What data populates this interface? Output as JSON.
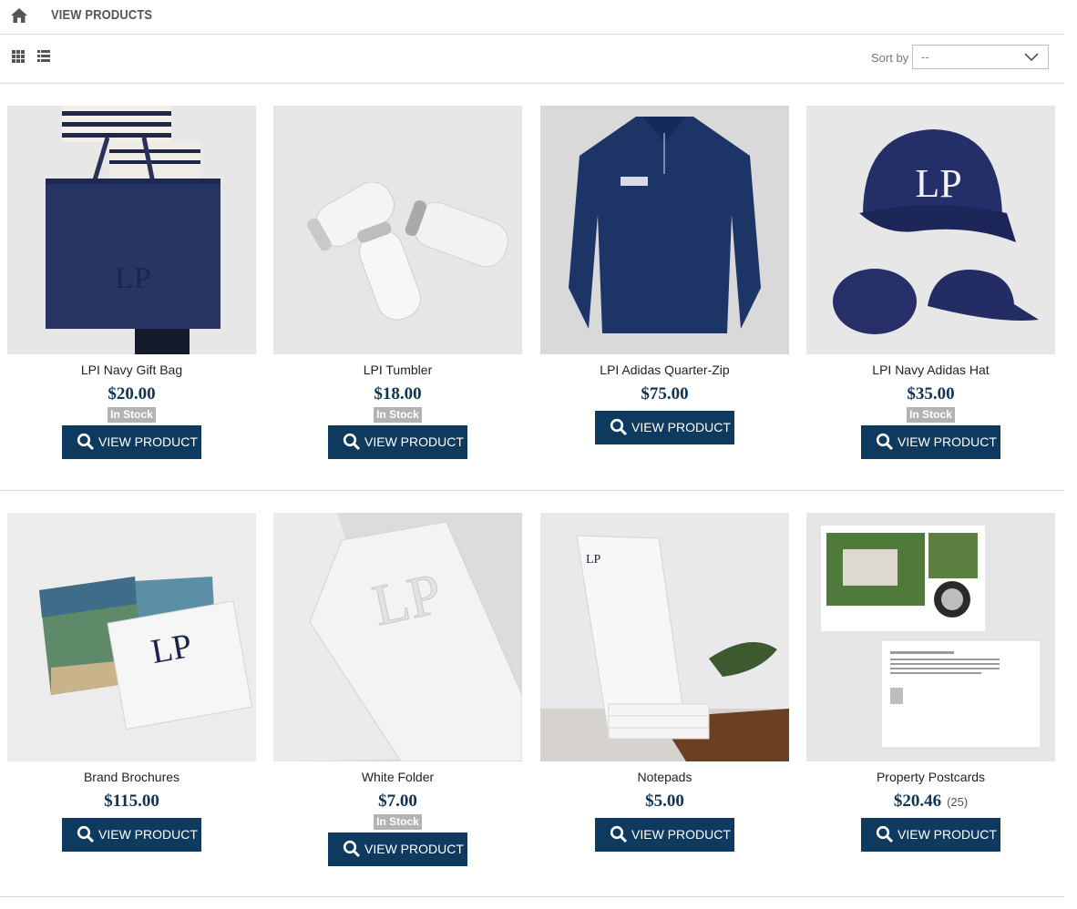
{
  "breadcrumb": {
    "title": "VIEW PRODUCTS"
  },
  "toolbar": {
    "sort_label": "Sort by",
    "sort_value": "--"
  },
  "colors": {
    "accent": "#0f3a5f",
    "price": "#0f3555",
    "badge": "#b3b3b3"
  },
  "products": [
    {
      "name": "LPI Navy Gift Bag",
      "price": "$20.00",
      "stock": "In Stock",
      "button": "VIEW PRODUCT"
    },
    {
      "name": "LPI Tumbler",
      "price": "$18.00",
      "stock": "In Stock",
      "button": "VIEW PRODUCT"
    },
    {
      "name": "LPI Adidas Quarter-Zip",
      "price": "$75.00",
      "button": "VIEW PRODUCT"
    },
    {
      "name": "LPI Navy Adidas Hat",
      "price": "$35.00",
      "stock": "In Stock",
      "button": "VIEW PRODUCT"
    },
    {
      "name": "Brand Brochures",
      "price": "$115.00",
      "button": "VIEW PRODUCT"
    },
    {
      "name": "White Folder",
      "price": "$7.00",
      "stock": "In Stock",
      "button": "VIEW PRODUCT"
    },
    {
      "name": "Notepads",
      "price": "$5.00",
      "button": "VIEW PRODUCT"
    },
    {
      "name": "Property Postcards",
      "price": "$20.46",
      "qty": "(25)",
      "button": "VIEW PRODUCT"
    }
  ]
}
